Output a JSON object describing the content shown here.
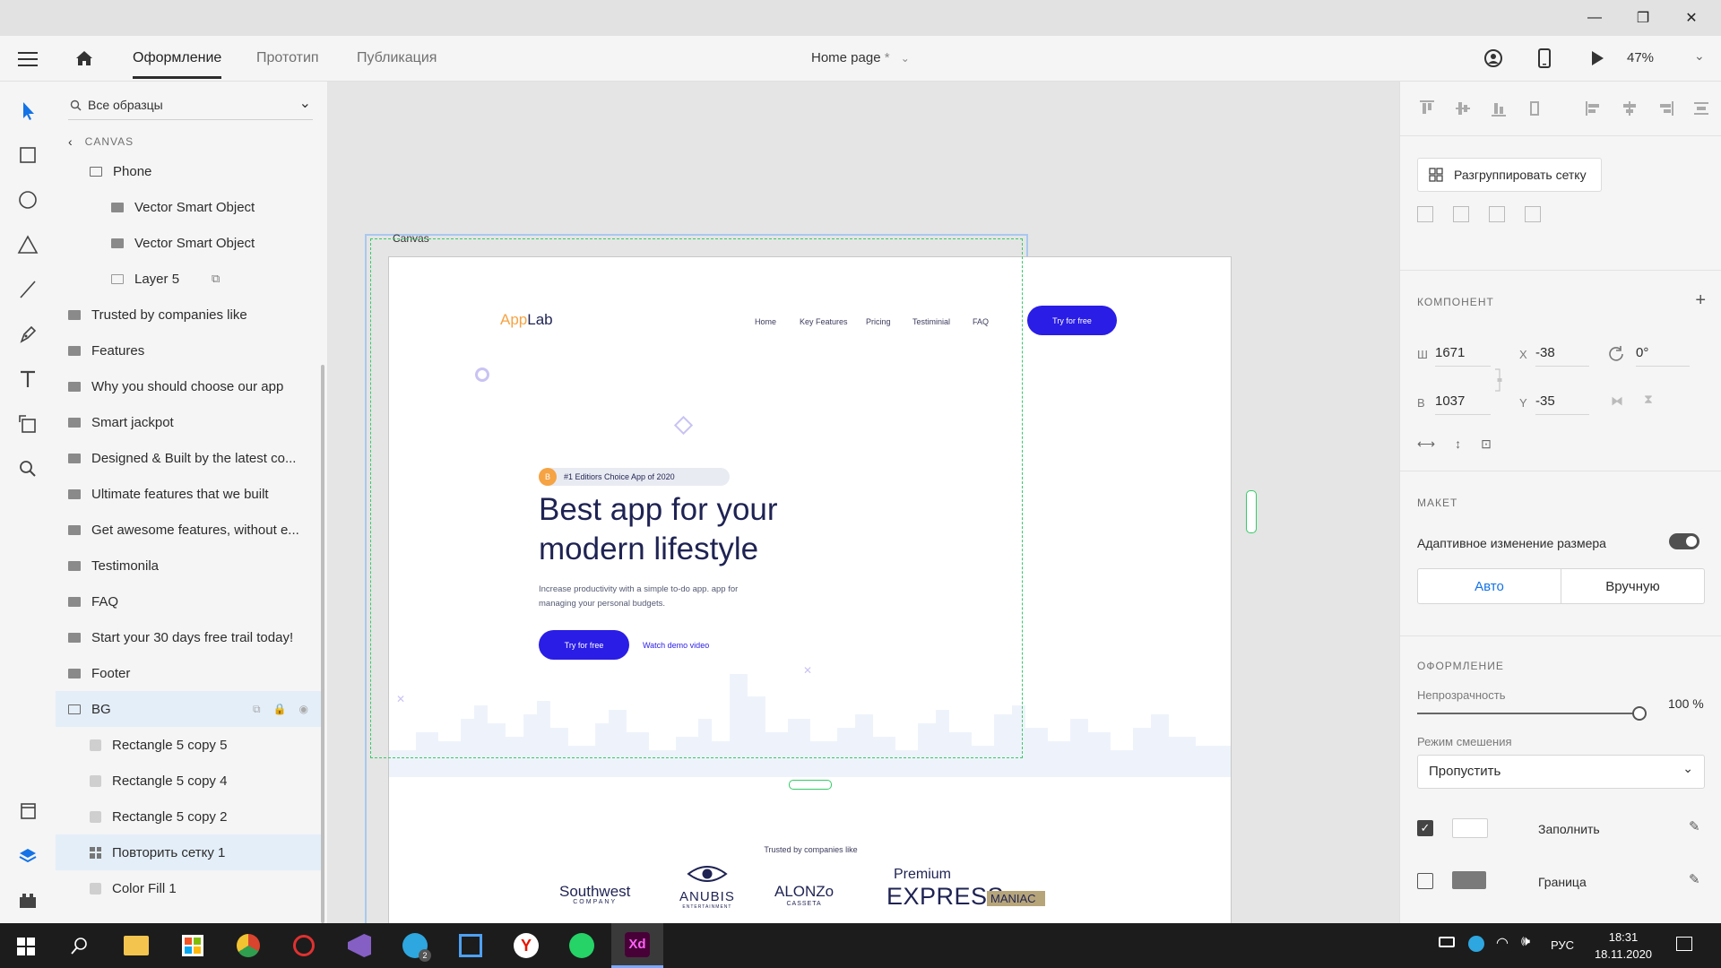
{
  "titlebar": {
    "minimize": "—",
    "maximize": "❐",
    "close": "✕"
  },
  "appbar": {
    "tabs": [
      {
        "label": "Оформление",
        "active": true
      },
      {
        "label": "Прототип",
        "active": false
      },
      {
        "label": "Публикация",
        "active": false
      }
    ],
    "document": "Home page",
    "modified_mark": "*",
    "zoom": "47%"
  },
  "layers": {
    "search_placeholder": "Все образцы",
    "parent": "CANVAS",
    "items": [
      {
        "label": "Phone",
        "type": "folder",
        "indent": 1
      },
      {
        "label": "Vector Smart Object",
        "type": "folder-filled",
        "indent": 2
      },
      {
        "label": "Vector Smart Object",
        "type": "folder-filled",
        "indent": 2
      },
      {
        "label": "Layer 5",
        "type": "image",
        "indent": 2
      },
      {
        "label": "Trusted by companies like",
        "type": "folder-filled",
        "indent": 0
      },
      {
        "label": "Features",
        "type": "folder-filled",
        "indent": 0
      },
      {
        "label": "Why you should choose our app",
        "type": "folder-filled",
        "indent": 0
      },
      {
        "label": "Smart jackpot",
        "type": "folder-filled",
        "indent": 0
      },
      {
        "label": "Designed & Built by the latest co...",
        "type": "folder-filled",
        "indent": 0
      },
      {
        "label": "Ultimate features that we built",
        "type": "folder-filled",
        "indent": 0
      },
      {
        "label": "Get awesome features, without e...",
        "type": "folder-filled",
        "indent": 0
      },
      {
        "label": "Testimonila",
        "type": "folder-filled",
        "indent": 0
      },
      {
        "label": "FAQ",
        "type": "folder-filled",
        "indent": 0
      },
      {
        "label": "Start your 30 days free trail today!",
        "type": "folder-filled",
        "indent": 0
      },
      {
        "label": "Footer",
        "type": "folder-filled",
        "indent": 0
      },
      {
        "label": "BG",
        "type": "folder",
        "indent": 0,
        "hover": true
      },
      {
        "label": "Rectangle 5 copy 5",
        "type": "rect",
        "indent": 1
      },
      {
        "label": "Rectangle 5 copy 4",
        "type": "rect",
        "indent": 1
      },
      {
        "label": "Rectangle 5 copy 2",
        "type": "rect",
        "indent": 1
      },
      {
        "label": "Повторить сетку 1",
        "type": "grid",
        "indent": 1,
        "selected": true
      },
      {
        "label": "Color Fill 1",
        "type": "rect",
        "indent": 1
      }
    ]
  },
  "canvas": {
    "artboard_label": "Canvas",
    "site": {
      "logo_a": "App",
      "logo_b": "Lab",
      "nav": [
        "Home",
        "Key Features",
        "Pricing",
        "Testiminial",
        "FAQ"
      ],
      "nav_cta": "Try for free",
      "badge_letter": "B",
      "badge": "#1 Editiors Choice App of 2020",
      "headline_1": "Best app for your",
      "headline_2": "modern lifestyle",
      "sub_1": "Increase productivity with a simple to-do app. app for",
      "sub_2": "managing your personal budgets.",
      "cta": "Try for free",
      "demo": "Watch demo video",
      "trusted": "Trusted by companies like",
      "brands": {
        "southwest_1": "Southwest",
        "southwest_2": "COMPANY",
        "anubis": "ANUBIS",
        "anubis_sub": "ENTERTAINMENT",
        "alonzo": "ALONZo",
        "alonzo_sub": "CASSETA",
        "premium": "Premium",
        "express": "EXPRESS",
        "maniac": "MANIAC"
      }
    }
  },
  "props": {
    "ungroup": "Разгруппировать сетку",
    "component": "КОМПОНЕНТ",
    "w_label": "Ш",
    "w": "1671",
    "h_label": "В",
    "h": "1037",
    "x_label": "X",
    "x": "-38",
    "y_label": "Y",
    "y": "-35",
    "rotation": "0°",
    "layout": "МАКЕТ",
    "responsive": "Адаптивное изменение размера",
    "auto": "Авто",
    "manual": "Вручную",
    "appearance": "ОФОРМЛЕНИЕ",
    "opacity_label": "Непрозрачность",
    "opacity": "100 %",
    "opacity_value": 1.0,
    "blend_label": "Режим смешения",
    "blend": "Пропустить",
    "fill": "Заполнить",
    "border": "Граница"
  },
  "taskbar": {
    "lang": "РУС",
    "time": "18:31",
    "date": "18.11.2020",
    "telegram_badge": "2"
  },
  "colors": {
    "accent": "#2a1de6",
    "logo_orange": "#f6a343",
    "headline": "#1f2353",
    "selection_blue": "#1473e6",
    "guide_green": "#33cc66"
  }
}
